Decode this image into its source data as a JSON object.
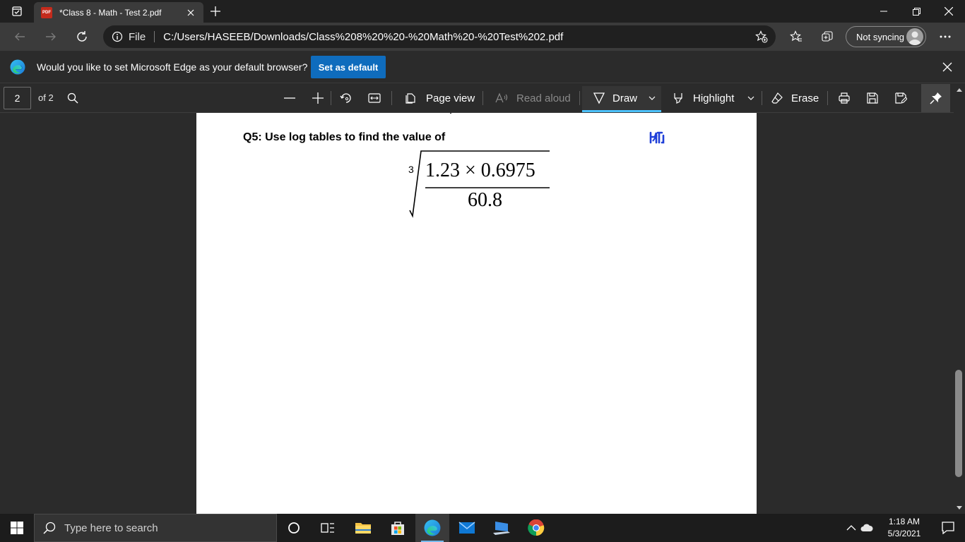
{
  "window": {
    "tab_title": "*Class 8 - Math - Test 2.pdf",
    "pdf_badge": "PDF"
  },
  "address_bar": {
    "scheme_label": "File",
    "url": "C:/Users/HASEEB/Downloads/Class%208%20%20-%20Math%20-%20Test%202.pdf"
  },
  "profile": {
    "sync_label": "Not syncing"
  },
  "banner": {
    "message": "Would you like to set Microsoft Edge as your default browser?",
    "button_label": "Set as default"
  },
  "pdf_toolbar": {
    "page_number": "2",
    "page_count_label": "of 2",
    "page_view_label": "Page view",
    "read_aloud_label": "Read aloud",
    "draw_label": "Draw",
    "highlight_label": "Highlight",
    "erase_label": "Erase"
  },
  "document": {
    "question": "Q5: Use log tables to find the value of",
    "root_index": "3",
    "numerator": "1.23 × 0.6975",
    "denominator": "60.8"
  },
  "taskbar": {
    "search_placeholder": "Type here to search",
    "time": "1:18 AM",
    "date": "5/3/2021"
  },
  "colors": {
    "accent": "#4cc2ff",
    "banner_button": "#0f6cbd",
    "page_background": "#ffffff"
  }
}
